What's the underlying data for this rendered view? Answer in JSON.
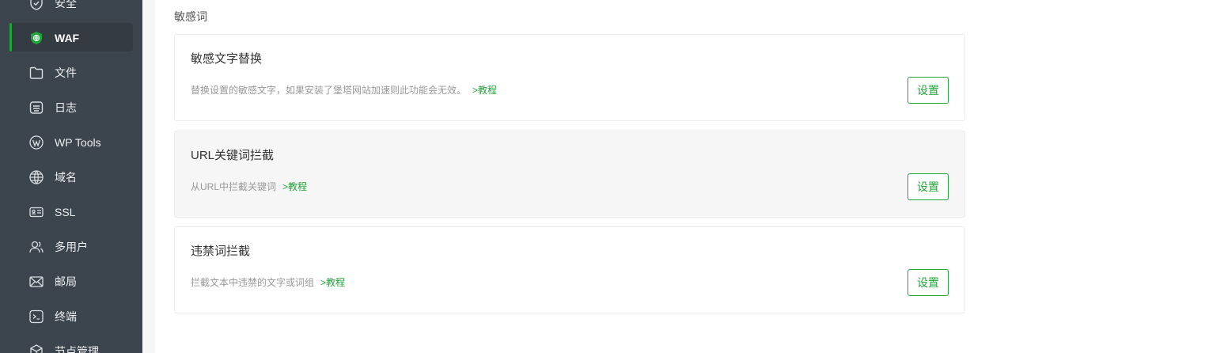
{
  "sidebar": {
    "items": [
      {
        "label": "安全",
        "icon": "shield-check-icon"
      },
      {
        "label": "WAF",
        "icon": "waf-shield-icon",
        "active": true
      },
      {
        "label": "文件",
        "icon": "folder-icon"
      },
      {
        "label": "日志",
        "icon": "log-icon"
      },
      {
        "label": "WP Tools",
        "icon": "wordpress-icon"
      },
      {
        "label": "域名",
        "icon": "globe-icon"
      },
      {
        "label": "SSL",
        "icon": "ssl-certificate-icon"
      },
      {
        "label": "多用户",
        "icon": "users-icon"
      },
      {
        "label": "邮局",
        "icon": "mail-icon"
      },
      {
        "label": "终端",
        "icon": "terminal-icon"
      },
      {
        "label": "节点管理",
        "icon": "node-cube-icon"
      }
    ],
    "accent_color": "#20a53a"
  },
  "main": {
    "section_title": "敏感词",
    "cards": [
      {
        "title": "敏感文字替换",
        "desc": "替换设置的敏感文字，如果安装了堡塔网站加速则此功能会无效。",
        "link": ">教程",
        "button": "设置"
      },
      {
        "title": "URL关键词拦截",
        "desc": "从URL中拦截关键词",
        "link": ">教程",
        "button": "设置"
      },
      {
        "title": "违禁词拦截",
        "desc": "拦截文本中违禁的文字或词组",
        "link": ">教程",
        "button": "设置"
      }
    ]
  }
}
